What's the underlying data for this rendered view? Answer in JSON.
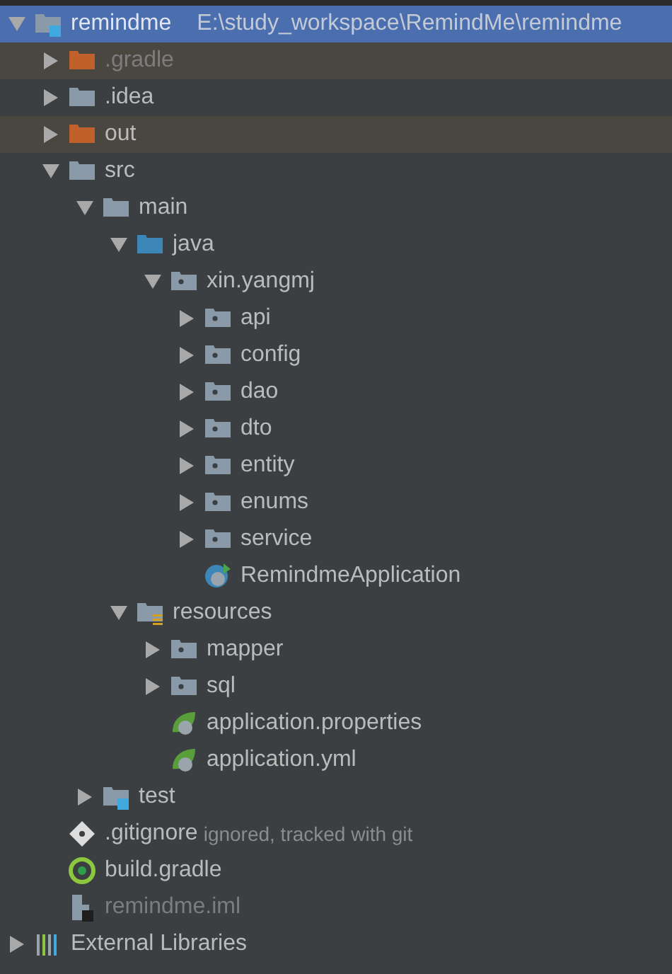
{
  "tree": [
    {
      "label": "remindme",
      "path": "E:\\study_workspace\\RemindMe\\remindme",
      "kind": "module-folder",
      "expanded": true,
      "selected": true,
      "children": [
        {
          "label": ".gradle",
          "kind": "excluded-folder",
          "expanded": false,
          "selected": false,
          "excluded": true,
          "dimmed": true
        },
        {
          "label": ".idea",
          "kind": "folder",
          "expanded": false,
          "selected": false
        },
        {
          "label": "out",
          "kind": "excluded-folder",
          "expanded": false,
          "selected": false,
          "excluded": true
        },
        {
          "label": "src",
          "kind": "folder",
          "expanded": true,
          "selected": false,
          "children": [
            {
              "label": "main",
              "kind": "folder",
              "expanded": true,
              "selected": false,
              "children": [
                {
                  "label": "java",
                  "kind": "source-root",
                  "expanded": true,
                  "selected": false,
                  "children": [
                    {
                      "label": "xin.yangmj",
                      "kind": "package",
                      "expanded": true,
                      "selected": false,
                      "children": [
                        {
                          "label": "api",
                          "kind": "package",
                          "expanded": false,
                          "selected": false
                        },
                        {
                          "label": "config",
                          "kind": "package",
                          "expanded": false,
                          "selected": false
                        },
                        {
                          "label": "dao",
                          "kind": "package",
                          "expanded": false,
                          "selected": false
                        },
                        {
                          "label": "dto",
                          "kind": "package",
                          "expanded": false,
                          "selected": false
                        },
                        {
                          "label": "entity",
                          "kind": "package",
                          "expanded": false,
                          "selected": false
                        },
                        {
                          "label": "enums",
                          "kind": "package",
                          "expanded": false,
                          "selected": false
                        },
                        {
                          "label": "service",
                          "kind": "package",
                          "expanded": false,
                          "selected": false
                        },
                        {
                          "label": "RemindmeApplication",
                          "kind": "spring-class",
                          "selected": false
                        }
                      ]
                    }
                  ]
                },
                {
                  "label": "resources",
                  "kind": "resources-root",
                  "expanded": true,
                  "selected": false,
                  "children": [
                    {
                      "label": "mapper",
                      "kind": "package",
                      "expanded": false,
                      "selected": false
                    },
                    {
                      "label": "sql",
                      "kind": "package",
                      "expanded": false,
                      "selected": false
                    },
                    {
                      "label": "application.properties",
                      "kind": "spring-config",
                      "selected": false
                    },
                    {
                      "label": "application.yml",
                      "kind": "spring-config",
                      "selected": false
                    }
                  ]
                }
              ]
            },
            {
              "label": "test",
              "kind": "test-root",
              "expanded": false,
              "selected": false
            }
          ]
        },
        {
          "label": ".gitignore",
          "note": "ignored, tracked with git",
          "kind": "git-file",
          "selected": false
        },
        {
          "label": "build.gradle",
          "kind": "gradle-file",
          "selected": false
        },
        {
          "label": "remindme.iml",
          "kind": "module-file",
          "selected": false,
          "dimmed": true
        }
      ]
    },
    {
      "label": "External Libraries",
      "kind": "libraries",
      "expanded": false,
      "selected": false
    }
  ]
}
